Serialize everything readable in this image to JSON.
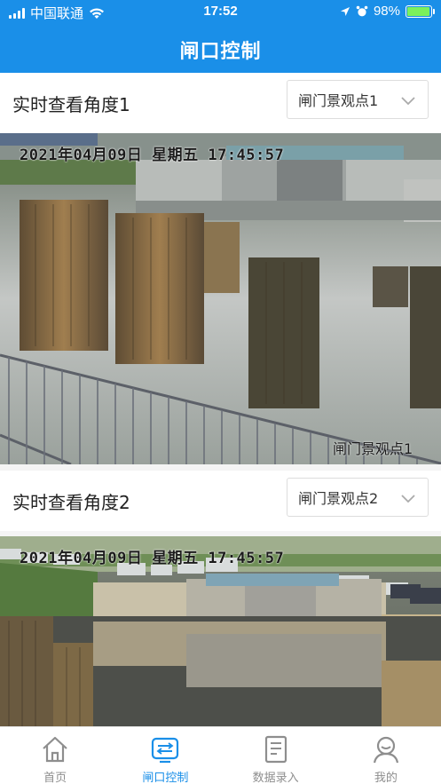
{
  "status_bar": {
    "carrier": "中国联通",
    "time": "17:52",
    "battery_percent": "98%",
    "battery_level": 0.98,
    "icons": [
      "signal-icon",
      "wifi-icon",
      "location-icon",
      "alarm-icon",
      "battery-icon"
    ]
  },
  "header": {
    "title": "闸口控制"
  },
  "views": [
    {
      "title": "实时查看角度1",
      "selected": "闸门景观点1",
      "osd_datetime": "2021年04月09日  星期五  17:45:57",
      "camera_label": "闸门景观点1"
    },
    {
      "title": "实时查看角度2",
      "selected": "闸门景观点2",
      "osd_datetime": "2021年04月09日  星期五  17:45:57"
    }
  ],
  "tabs": [
    {
      "label": "首页",
      "icon": "home-icon"
    },
    {
      "label": "闸口控制",
      "icon": "gate-control-icon",
      "active": true
    },
    {
      "label": "数据录入",
      "icon": "document-icon"
    },
    {
      "label": "我的",
      "icon": "profile-icon"
    }
  ],
  "colors": {
    "brand": "#1a8fe8",
    "tab_inactive": "#8e8e8e"
  }
}
